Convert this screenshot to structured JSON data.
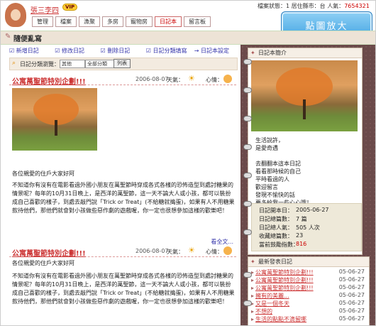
{
  "header": {
    "username": "張三李四",
    "vip": "VIP",
    "info_label": "檔案狀態：",
    "info_value": "1",
    "info_sep": "居住縣市：",
    "info_mid": "台",
    "info_count_label": "人氣：",
    "info_count": "7654321"
  },
  "nav": [
    "管理",
    "檔案",
    "漁聚",
    "多房",
    "寵物房",
    "日記本",
    "留言板"
  ],
  "zoom_label": "點圖放大",
  "page_title": "隨便亂寫",
  "tools": {
    "new": "新增日記",
    "edit": "修改日記",
    "delete": "刪除日記",
    "class": "日記分類填寫",
    "settings": "日記本設定"
  },
  "filter": {
    "label": "日記分類瀏覽：",
    "sel1": "其他",
    "sel2": "全部分類",
    "button": "列表"
  },
  "posts": [
    {
      "title": "公寓萬聖節特別企劃!!!",
      "date": "2006-08-07",
      "weather_label": "天氣：",
      "mood_label": "心情：",
      "caption": "各位親愛的住戶大家好阿",
      "body": "不知道你有沒有在電影看過外國小朋友在萬聖節時穿成各式各樣的恐怖造型到處討糖果的情景呢？每年的10月31日晚上，是西洋的萬聖節，這一天不論大人或小孩，都可以裝扮成自己喜歡的樣子，到處去敲門說「Trick or Treat」(不給糖就搗蛋)，如果有人不用糖果款待他們，那他們就會對小孩做些惡作劇的遊戲喔，你一定也很想參加這樣的歡樂吧！",
      "more": "看全文..."
    },
    {
      "title": "公寓萬聖節特別企劃!!!",
      "date": "2006-08-07",
      "weather_label": "天氣：",
      "mood_label": "心情：",
      "caption": "各位親愛的住戶大家好阿",
      "body": "不知道你有沒有在電影看過外國小朋友在萬聖節時穿成各式各樣的恐怖造型到處討糖果的情景呢？每年的10月31日晚上，是西洋的萬聖節，這一天不論大人或小孩，都可以裝扮成自己喜歡的樣子，到處去敲門說「Trick or Treat」(不給糖就搗蛋)，如果有人不用糖果款待他們，那他們就會對小孩做些惡作劇的遊戲喔，你一定也很想參加這樣的歡樂吧！",
      "more": ""
    }
  ],
  "sidebar": {
    "card_title": "日記本簡介",
    "intro": [
      "生活說許，",
      "是愛奇遇",
      "",
      "去翻翻本這本日記",
      "看看那時候的自己",
      "平時看過的人",
      "歡迎留言",
      "發現不愉快的話",
      "要多給我一些心心哦！"
    ],
    "stats": [
      {
        "label": "日記開本日：",
        "value": "2005-06-27",
        "red": false
      },
      {
        "label": "日記總篇數：",
        "value": "7 篇",
        "red": false
      },
      {
        "label": "日記總人氣：",
        "value": "505 人次",
        "red": false
      },
      {
        "label": "收藏總篇數：",
        "value": "23",
        "red": false
      },
      {
        "label": "當前鼓勵指數：",
        "value": "816",
        "red": true
      }
    ],
    "latest_title": "最新發表日記",
    "latest": [
      {
        "title": "公寓萬聖節特別企劃!!!",
        "date": "05-06-27"
      },
      {
        "title": "公寓萬聖節特別企劃!!!",
        "date": "05-06-27"
      },
      {
        "title": "公寓萬聖節特別企劃!!!",
        "date": "05-06-27"
      },
      {
        "title": "擁有的美麗...",
        "date": "05-06-27"
      },
      {
        "title": "又是一個冬天",
        "date": "05-06-27"
      },
      {
        "title": "不想的",
        "date": "05-06-27"
      },
      {
        "title": "生活的點點不滴留哪",
        "date": "05-06-27"
      }
    ]
  }
}
